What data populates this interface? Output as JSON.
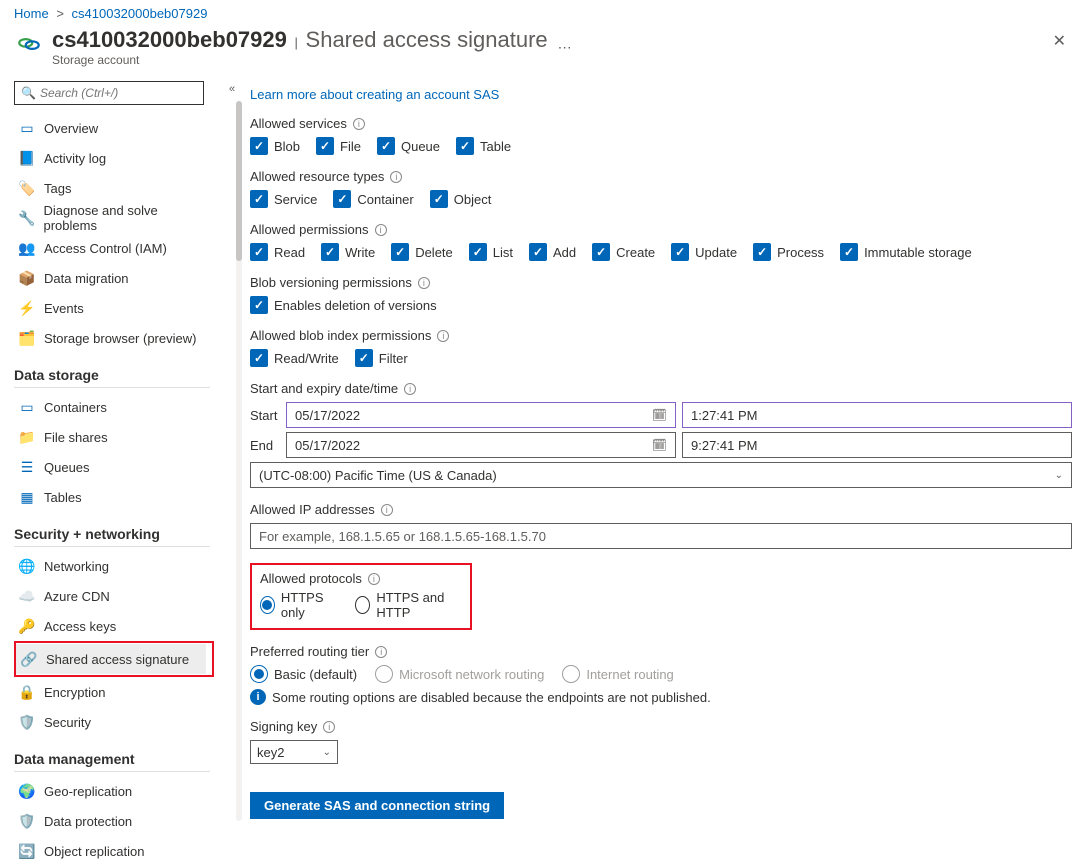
{
  "breadcrumb": {
    "home": "Home",
    "resource": "cs410032000beb07929"
  },
  "header": {
    "title": "cs410032000beb07929",
    "sub": "Shared access signature",
    "subtitle": "Storage account"
  },
  "sidebar": {
    "search_placeholder": "Search (Ctrl+/)",
    "general": [
      {
        "label": "Overview"
      },
      {
        "label": "Activity log"
      },
      {
        "label": "Tags"
      },
      {
        "label": "Diagnose and solve problems"
      },
      {
        "label": "Access Control (IAM)"
      },
      {
        "label": "Data migration"
      },
      {
        "label": "Events"
      },
      {
        "label": "Storage browser (preview)"
      }
    ],
    "data_storage_title": "Data storage",
    "data_storage": [
      {
        "label": "Containers"
      },
      {
        "label": "File shares"
      },
      {
        "label": "Queues"
      },
      {
        "label": "Tables"
      }
    ],
    "security_title": "Security + networking",
    "security": [
      {
        "label": "Networking"
      },
      {
        "label": "Azure CDN"
      },
      {
        "label": "Access keys"
      },
      {
        "label": "Shared access signature"
      },
      {
        "label": "Encryption"
      },
      {
        "label": "Security"
      }
    ],
    "data_mgmt_title": "Data management",
    "data_mgmt": [
      {
        "label": "Geo-replication"
      },
      {
        "label": "Data protection"
      },
      {
        "label": "Object replication"
      }
    ]
  },
  "content": {
    "learn_link": "Learn more about creating an account SAS",
    "allowed_services": {
      "label": "Allowed services",
      "items": [
        "Blob",
        "File",
        "Queue",
        "Table"
      ]
    },
    "allowed_resource_types": {
      "label": "Allowed resource types",
      "items": [
        "Service",
        "Container",
        "Object"
      ]
    },
    "allowed_permissions": {
      "label": "Allowed permissions",
      "items": [
        "Read",
        "Write",
        "Delete",
        "List",
        "Add",
        "Create",
        "Update",
        "Process",
        "Immutable storage"
      ]
    },
    "blob_versioning": {
      "label": "Blob versioning permissions",
      "items": [
        "Enables deletion of versions"
      ]
    },
    "blob_index": {
      "label": "Allowed blob index permissions",
      "items": [
        "Read/Write",
        "Filter"
      ]
    },
    "datetime": {
      "label": "Start and expiry date/time",
      "start_lbl": "Start",
      "start_date": "05/17/2022",
      "start_time": "1:27:41 PM",
      "end_lbl": "End",
      "end_date": "05/17/2022",
      "end_time": "9:27:41 PM",
      "tz": "(UTC-08:00) Pacific Time (US & Canada)"
    },
    "allowed_ip": {
      "label": "Allowed IP addresses",
      "placeholder": "For example, 168.1.5.65 or 168.1.5.65-168.1.5.70"
    },
    "allowed_protocols": {
      "label": "Allowed protocols",
      "opt1": "HTTPS only",
      "opt2": "HTTPS and HTTP"
    },
    "routing": {
      "label": "Preferred routing tier",
      "opt1": "Basic (default)",
      "opt2": "Microsoft network routing",
      "opt3": "Internet routing",
      "note": "Some routing options are disabled because the endpoints are not published."
    },
    "signing_key": {
      "label": "Signing key",
      "value": "key2"
    },
    "generate_btn": "Generate SAS and connection string"
  }
}
